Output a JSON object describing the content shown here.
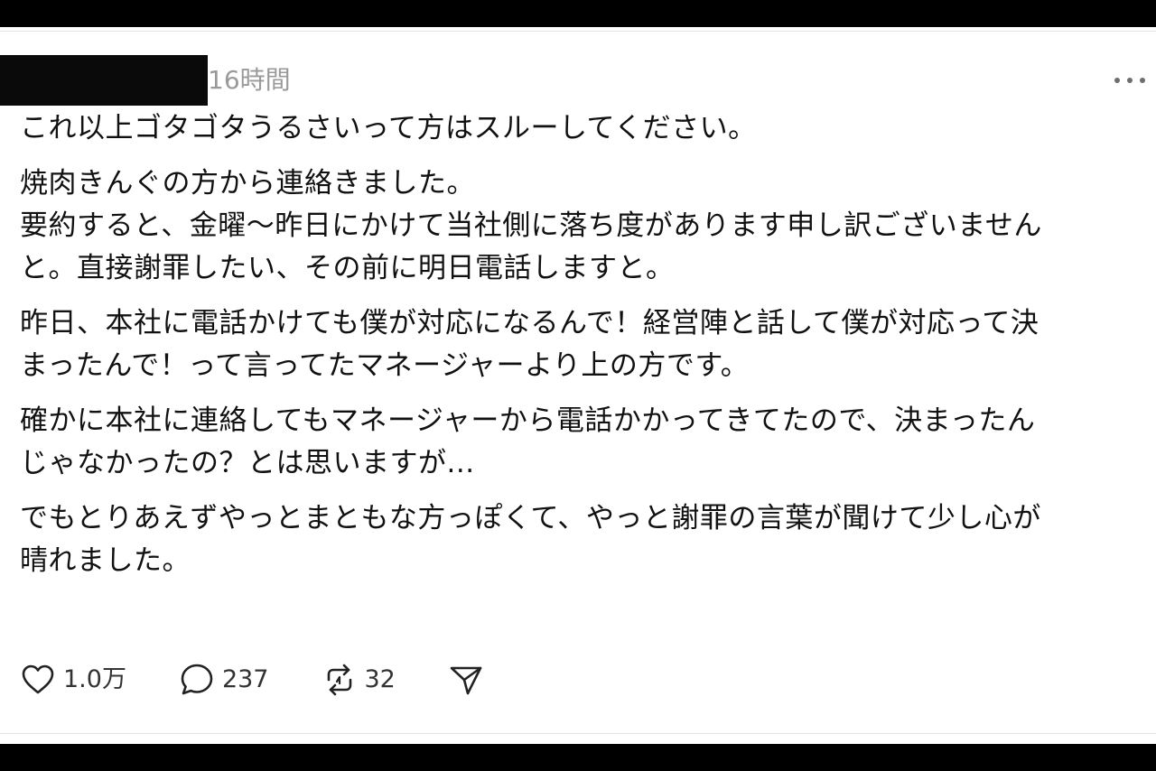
{
  "post": {
    "author_name": "",
    "timestamp": "16時間",
    "paragraphs": [
      "これ以上ゴタゴタうるさいって方はスルーしてください。",
      "焼肉きんぐの方から連絡きました。\n要約すると、金曜〜昨日にかけて当社側に落ち度があります申し訳ございません\nと。直接謝罪したい、その前に明日電話しますと。",
      "昨日、本社に電話かけても僕が対応になるんで！経営陣と話して僕が対応って決\nまったんで！って言ってたマネージャーより上の方です。",
      "確かに本社に連絡してもマネージャーから電話かかってきてたので、決まったん\nじゃなかったの？とは思いますが...",
      "でもとりあえずやっとまともな方っぽくて、やっと謝罪の言葉が聞けて少し心が\n晴れました。"
    ]
  },
  "actions": {
    "likes": "1.0万",
    "replies": "237",
    "reposts": "32"
  },
  "icons": {
    "like": "heart-icon",
    "reply": "comment-bubble-icon",
    "repost": "repost-icon",
    "share": "send-icon",
    "more": "more-dots-icon"
  },
  "colors": {
    "background": "#ffffff",
    "text": "#111111",
    "muted": "#9a9a9a",
    "icon": "#222222"
  }
}
